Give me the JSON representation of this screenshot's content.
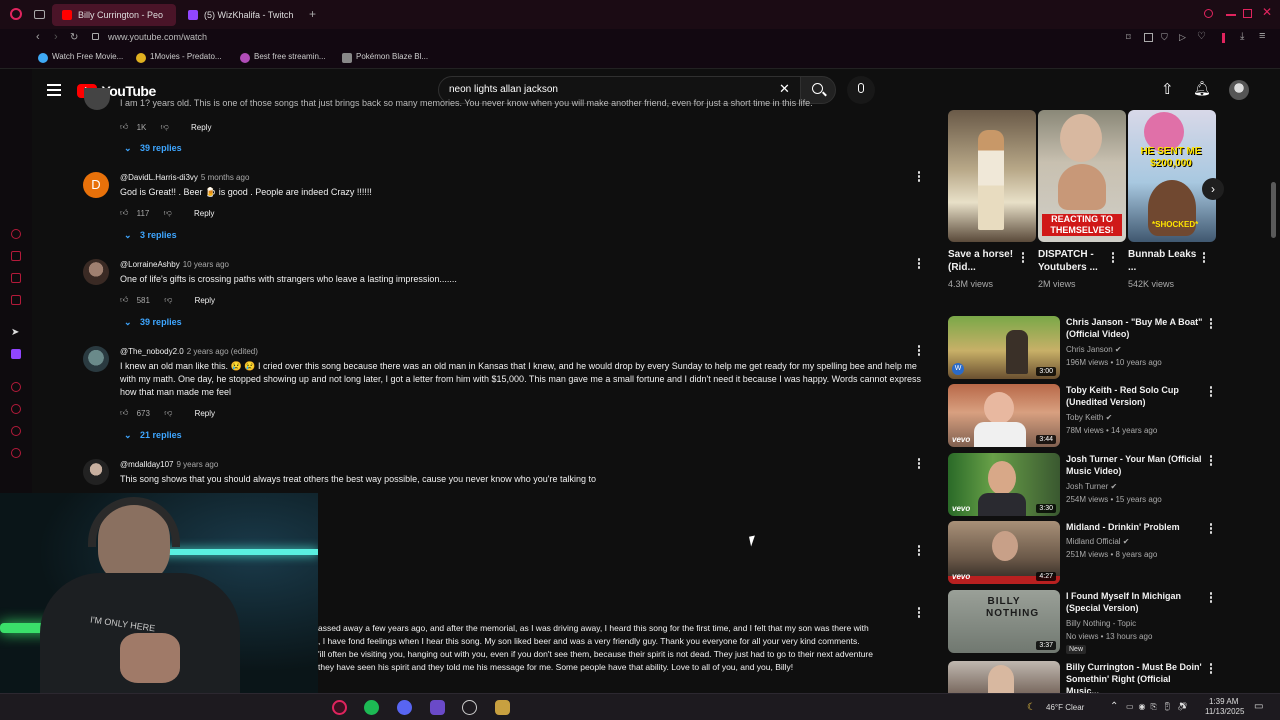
{
  "browser": {
    "tabs": [
      {
        "label": "Billy Currington - Peo",
        "active": true
      },
      {
        "label": "(5) WizKhalifa - Twitch",
        "active": false
      }
    ],
    "url": "www.youtube.com/watch",
    "bookmarks": [
      "Watch Free Movie...",
      "1Movies - Predato...",
      "Best free streamin...",
      "Pokémon Blaze Bl..."
    ]
  },
  "youtube": {
    "logo_text": "YouTube",
    "search_value": "neon lights allan jackson"
  },
  "comments": [
    {
      "partial_text": "I am 1? years old. This is one of those songs that just brings back so many memories. You never know when you will make another friend, even for just a short time in this life.",
      "likes": "1K",
      "reply_label": "Reply",
      "replies": "39 replies"
    },
    {
      "author": "@DavidL.Harris-di3vy",
      "ago": "5 months ago",
      "text": "God is Great!! . Beer 🍺 is good . People are indeed Crazy !!!!!!",
      "likes": "117",
      "reply_label": "Reply",
      "replies": "3 replies",
      "avatar_letter": "D"
    },
    {
      "author": "@LorraineAshby",
      "ago": "10 years ago",
      "text": "One of life's gifts is crossing paths with strangers who leave a lasting impression.......",
      "likes": "581",
      "reply_label": "Reply",
      "replies": "39 replies"
    },
    {
      "author": "@The_nobody2.0",
      "ago": "2 years ago (edited)",
      "text": "I knew an old man like this. 😢 😢 I cried over this song because there was an old man in Kansas that I knew, and he would drop by every Sunday to help me get ready for my spelling bee and help me with my math. One day, he stopped showing up and not long later, I got a letter from him with $15,000. This man gave me a small fortune and I didn't need it because I was happy. Words cannot express how that man made me feel",
      "likes": "673",
      "reply_label": "Reply",
      "replies": "21 replies"
    },
    {
      "author": "@mdallday107",
      "ago": "9 years ago",
      "text": "This song shows that you should always treat others the best way possible, cause you never know who you're talking to"
    },
    {
      "partial_lines": [
        "assed away a few years ago, and after the memorial, as I was driving away,  I heard this song for the first time, and I felt that my son was there with",
        ", I have fond feelings when I hear this song. My son liked beer and was a very friendly guy. Thank you everyone for all your very kind comments.",
        "'ill often be visiting you, hanging out with you, even if you don't see them, because their spirit is not dead. They just had to go to their next adventure",
        " they have seen his spirit and they told me his message for me. Some people have that ability. Love to all of you, and you, Billy!"
      ]
    }
  ],
  "shorts": [
    {
      "title": "Save a horse! (Rid...",
      "views": "4.3M views"
    },
    {
      "title": "DISPATCH - Youtubers ...",
      "views": "2M views",
      "overlay": "REACTING TO THEMSELVES!"
    },
    {
      "title": "Bunnab Leaks ...",
      "views": "542K views",
      "overlay": "HE SENT ME $200,000",
      "overlay2": "*SHOCKED*"
    }
  ],
  "videos": [
    {
      "title": "Chris Janson - \"Buy Me A Boat\" (Official Video)",
      "channel": "Chris Janson",
      "meta": "196M views • 10 years ago",
      "duration": "3:00"
    },
    {
      "title": "Toby Keith - Red Solo Cup (Unedited Version)",
      "channel": "Toby Keith",
      "meta": "78M views • 14 years ago",
      "duration": "3:44",
      "vevo": "vevo"
    },
    {
      "title": "Josh Turner - Your Man (Official Music Video)",
      "channel": "Josh Turner",
      "meta": "254M views • 15 years ago",
      "duration": "3:30",
      "vevo": "vevo"
    },
    {
      "title": "Midland - Drinkin' Problem",
      "channel": "Midland Official",
      "meta": "251M views • 8 years ago",
      "duration": "4:27",
      "vevo": "vevo"
    },
    {
      "title": "I Found Myself In Michigan (Special Version)",
      "channel": "Billy Nothing - Topic",
      "meta": "No views • 13 hours ago",
      "duration": "3:37",
      "badge": "New",
      "thumb_text": "BILLY NOTHING"
    },
    {
      "title": "Billy Currington - Must Be Doin' Somethin' Right (Official Music..."
    }
  ],
  "taskbar": {
    "weather": "46°F  Clear",
    "time": "1:39 AM",
    "date": "11/13/2025"
  },
  "webcam": {
    "shirt_text": "I'M ONLY HERE"
  }
}
